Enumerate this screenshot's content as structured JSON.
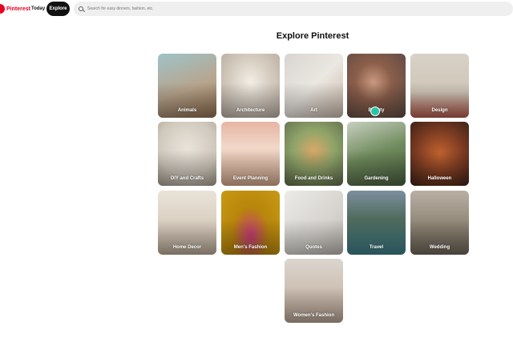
{
  "header": {
    "logo_text": "Pinterest",
    "nav_today": "Today",
    "nav_explore": "Explore",
    "search_placeholder": "Search for easy dinners, fashion, etc."
  },
  "page": {
    "title": "Explore Pinterest"
  },
  "categories": [
    {
      "label": "Animals"
    },
    {
      "label": "Architecture"
    },
    {
      "label": "Art"
    },
    {
      "label": "Beauty"
    },
    {
      "label": "Design"
    },
    {
      "label": "DIY and Crafts"
    },
    {
      "label": "Event Planning"
    },
    {
      "label": "Food and Drinks"
    },
    {
      "label": "Gardening"
    },
    {
      "label": "Halloween"
    },
    {
      "label": "Home Decor"
    },
    {
      "label": "Men's Fashion"
    },
    {
      "label": "Quotes"
    },
    {
      "label": "Travel"
    },
    {
      "label": "Wedding"
    },
    {
      "label": "Women's Fashion"
    }
  ],
  "colors": {
    "brand": "#e60023",
    "explore_active_bg": "#111111",
    "search_bg": "#efefef"
  }
}
